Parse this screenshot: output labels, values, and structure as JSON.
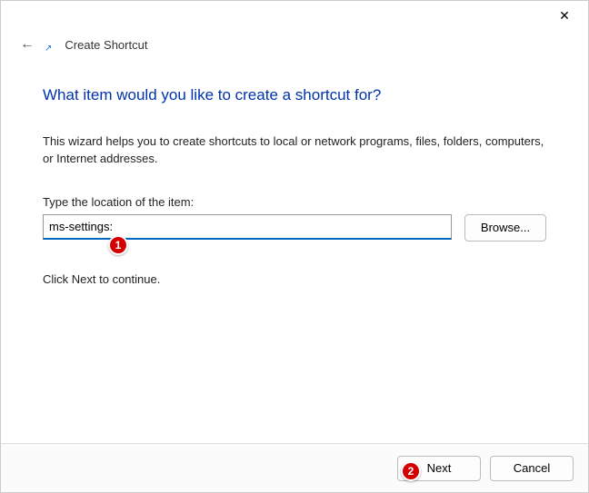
{
  "titlebar": {
    "close": "✕"
  },
  "header": {
    "back_glyph": "←",
    "shortcut_glyph": "↗",
    "title": "Create Shortcut"
  },
  "content": {
    "heading": "What item would you like to create a shortcut for?",
    "description": "This wizard helps you to create shortcuts to local or network programs, files, folders, computers, or Internet addresses.",
    "input_label": "Type the location of the item:",
    "input_value": "ms-settings:",
    "browse": "Browse...",
    "continue": "Click Next to continue."
  },
  "footer": {
    "next": "Next",
    "cancel": "Cancel"
  },
  "callouts": {
    "c1": "1",
    "c2": "2"
  }
}
